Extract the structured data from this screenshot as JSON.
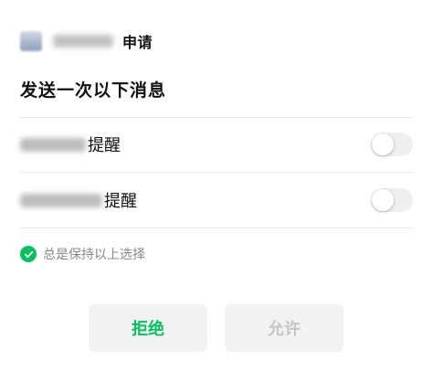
{
  "header": {
    "app_icon": "app-logo-icon",
    "suffix": "申请"
  },
  "title": "发送一次以下消息",
  "options": [
    {
      "label_suffix": "提醒",
      "enabled": false
    },
    {
      "label_suffix": "提醒",
      "enabled": false
    }
  ],
  "keep_choice": {
    "icon": "check-circle-icon",
    "label": "总是保持以上选择",
    "checked": true
  },
  "buttons": {
    "reject_label": "拒绝",
    "allow_label": "允许"
  },
  "colors": {
    "accent_green": "#07c160",
    "button_bg": "#f2f2f2",
    "disabled_text": "#c6c6c6",
    "divider": "#e9e9e9",
    "toggle_off": "#efefef"
  }
}
